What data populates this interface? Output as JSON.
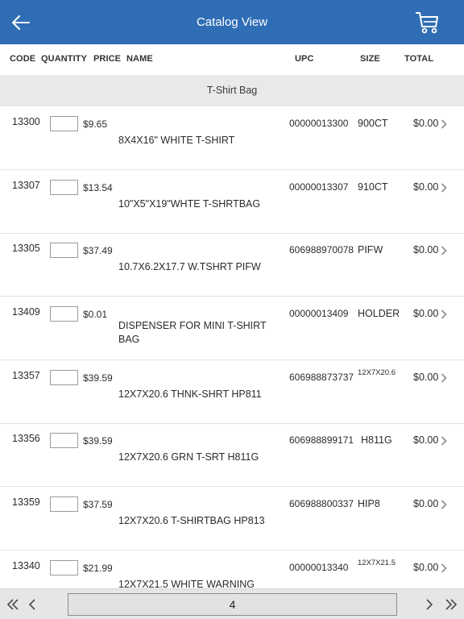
{
  "header": {
    "title": "Catalog View",
    "back_icon": "back-arrow-icon",
    "cart_icon": "cart-icon"
  },
  "columns": {
    "code": "CODE",
    "quantity": "QUANTITY",
    "price": "PRICE",
    "name": "NAME",
    "upc": "UPC",
    "size": "SIZE",
    "total": "TOTAL"
  },
  "section": {
    "title": "T-Shirt Bag"
  },
  "rows": [
    {
      "code": "13300",
      "price": "$9.65",
      "name": "8X4X16\" WHITE T-SHIRT",
      "upc": "00000013300",
      "size": "900CT",
      "total": "$0.00",
      "quantity": ""
    },
    {
      "code": "13307",
      "price": "$13.54",
      "name": "10\"X5\"X19\"WHTE T-SHRTBAG",
      "upc": "00000013307",
      "size": "910CT",
      "total": "$0.00",
      "quantity": ""
    },
    {
      "code": "13305",
      "price": "$37.49",
      "name": "10.7X6.2X17.7 W.TSHRT PIFW",
      "upc": "606988970078",
      "size": "PIFW",
      "total": "$0.00",
      "quantity": ""
    },
    {
      "code": "13409",
      "price": "$0.01",
      "name": "DISPENSER FOR MINI T-SHIRT BAG",
      "upc": "00000013409",
      "size": "HOLDER",
      "total": "$0.00",
      "quantity": ""
    },
    {
      "code": "13357",
      "price": "$39.59",
      "name": "12X7X20.6 THNK-SHRT HP811",
      "upc": "606988873737",
      "size": "12X7X20.6",
      "total": "$0.00",
      "quantity": ""
    },
    {
      "code": "13356",
      "price": "$39.59",
      "name": "12X7X20.6 GRN T-SRT H811G",
      "upc": "606988899171",
      "size": "H811G",
      "total": "$0.00",
      "quantity": ""
    },
    {
      "code": "13359",
      "price": "$37.59",
      "name": "12X7X20.6 T-SHIRTBAG HP813",
      "upc": "606988800337",
      "size": "HIP8",
      "total": "$0.00",
      "quantity": ""
    },
    {
      "code": "13340",
      "price": "$21.99",
      "name": "12X7X21.5 WHITE WARNING",
      "upc": "00000013340",
      "size": "12X7X21.5",
      "total": "$0.00",
      "quantity": ""
    }
  ],
  "pagination": {
    "current_page": "4",
    "first_icon": "double-chevron-left-icon",
    "prev_icon": "chevron-left-icon",
    "next_icon": "chevron-right-icon",
    "last_icon": "double-chevron-right-icon"
  },
  "colors": {
    "header_bg": "#2f6db5",
    "section_bg": "#e9e9e9",
    "bottom_bar_bg": "#e6e6e6"
  }
}
